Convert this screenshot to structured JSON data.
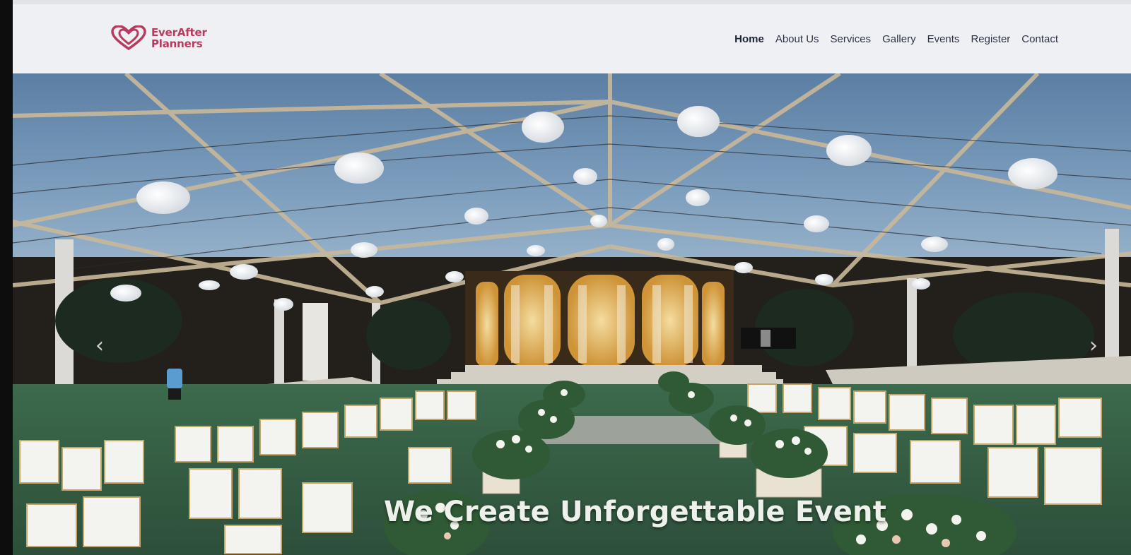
{
  "brand": {
    "line1": "EverAfter",
    "line2": "Planners",
    "color": "#b83a5e",
    "icon": "double-heart-icon"
  },
  "nav": {
    "items": [
      {
        "label": "Home",
        "active": true
      },
      {
        "label": "About Us",
        "active": false
      },
      {
        "label": "Services",
        "active": false
      },
      {
        "label": "Gallery",
        "active": false
      },
      {
        "label": "Events",
        "active": false
      },
      {
        "label": "Register",
        "active": false
      },
      {
        "label": "Contact",
        "active": false
      }
    ]
  },
  "hero": {
    "title": "We Create Unforgettable Event",
    "prev_icon": "chevron-left-icon",
    "next_icon": "chevron-right-icon"
  }
}
